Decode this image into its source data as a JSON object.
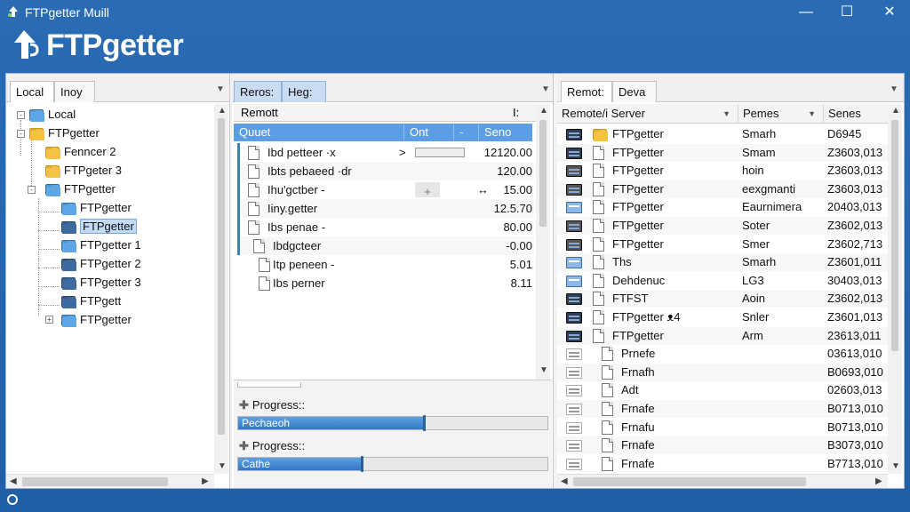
{
  "window": {
    "title": "FTPgetter Muill",
    "brand": "FTPgetter",
    "controls": {
      "minimize": "—",
      "maximize": "☐",
      "close": "✕"
    }
  },
  "left_pane": {
    "tabs": [
      {
        "label": "Local"
      },
      {
        "label": "Inoy"
      }
    ],
    "tree": [
      {
        "label": "Local",
        "icon": "folder-blue-icon"
      },
      {
        "label": "FTPgetter",
        "icon": "folder-yellow-icon"
      },
      {
        "label": "Fenncer 2",
        "icon": "folder-yellow-icon"
      },
      {
        "label": "FTPgeter 3",
        "icon": "folder-yellow-icon"
      },
      {
        "label": "FTPgetter",
        "icon": "folder-blue-icon"
      },
      {
        "label": "FTPgetter",
        "icon": "folder-blue-icon"
      },
      {
        "label": "FTPgetter",
        "icon": "folder-dark-icon",
        "selected": true
      },
      {
        "label": "FTPgetter 1",
        "icon": "folder-blue-icon"
      },
      {
        "label": "FTPgetter 2",
        "icon": "folder-dark-icon"
      },
      {
        "label": "FTPgetter 3",
        "icon": "folder-dark-icon"
      },
      {
        "label": "FTPgett",
        "icon": "folder-dark-icon"
      },
      {
        "label": "FTPgetter",
        "icon": "folder-blue-icon"
      }
    ]
  },
  "middle_pane": {
    "tabs": [
      {
        "label": "Reros:"
      },
      {
        "label": "Heg:"
      }
    ],
    "header_label": "Remott",
    "header_right": "I:",
    "queue_columns": [
      "Quuet",
      "Ont",
      "-",
      "Seno"
    ],
    "queue": [
      {
        "name": "Ibd petteer ·x",
        "value": "12120.00",
        "action": ">"
      },
      {
        "name": "Ibts pebaeed ·dr",
        "value": "120.00",
        "action": ""
      },
      {
        "name": "Ihu'gctber -",
        "value": "15.00",
        "action": "↔"
      },
      {
        "name": "Iiny.getter",
        "value": "12.5.70",
        "action": ""
      },
      {
        "name": "Ibs penae -",
        "value": "80.00",
        "action": ""
      },
      {
        "name": "Ibdgcteer",
        "value": "-0.00",
        "action": ""
      },
      {
        "name": "Itp peneen -",
        "value": "5.01",
        "action": ""
      },
      {
        "name": "Ibs perner",
        "value": "8.11",
        "action": ""
      }
    ],
    "progress": [
      {
        "label": "Progress::",
        "bar_text": "Pechaeoh",
        "fraction": 0.6
      },
      {
        "label": "Progress::",
        "bar_text": "Cathe",
        "fraction": 0.4
      }
    ]
  },
  "right_pane": {
    "tabs": [
      {
        "label": "Remot:"
      },
      {
        "label": "Deva"
      }
    ],
    "columns": [
      "Remote/i Server",
      "Pemes",
      "Senes"
    ],
    "rows": [
      {
        "name": "FTPgetter",
        "col2": "Smarh",
        "col3": "D6945",
        "icon": "folder"
      },
      {
        "name": "FTPgetter",
        "col2": "Smam",
        "col3": "Z3603,013",
        "icon": "file"
      },
      {
        "name": "FTPgetter",
        "col2": "hoin",
        "col3": "Z3603,013",
        "icon": "file"
      },
      {
        "name": "FTPgetter",
        "col2": "eexgmanti",
        "col3": "Z3603,013",
        "icon": "file"
      },
      {
        "name": "FTPgetter",
        "col2": "Eaurnimera",
        "col3": "20403,013",
        "icon": "file"
      },
      {
        "name": "FTPgetter",
        "col2": "Soter",
        "col3": "Z3602,013",
        "icon": "file"
      },
      {
        "name": "FTPgetter",
        "col2": "Smer",
        "col3": "Z3602,713",
        "icon": "file"
      },
      {
        "name": "Ths",
        "col2": "Smarh",
        "col3": "Z3601,011",
        "icon": "file"
      },
      {
        "name": "Dehdenuc",
        "col2": "LG3",
        "col3": "30403,013",
        "icon": "file"
      },
      {
        "name": "FTFST",
        "col2": "Aoin",
        "col3": "Z3602,013",
        "icon": "file"
      },
      {
        "name": "FTPgetter ᴥ4",
        "col2": "Snler",
        "col3": "Z3601,013",
        "icon": "file"
      },
      {
        "name": "FTPgetter",
        "col2": "Arm",
        "col3": "23613,011",
        "icon": "file"
      },
      {
        "name": "Prnefe",
        "col2": "",
        "col3": "03613,010",
        "icon": "file"
      },
      {
        "name": "Frnafh",
        "col2": "",
        "col3": "B0693,010",
        "icon": "file"
      },
      {
        "name": "Adt",
        "col2": "",
        "col3": "02603,013",
        "icon": "file"
      },
      {
        "name": "Frnafe",
        "col2": "",
        "col3": "B0713,010",
        "icon": "file"
      },
      {
        "name": "Frnafu",
        "col2": "",
        "col3": "B0713,010",
        "icon": "file"
      },
      {
        "name": "Frnafe",
        "col2": "",
        "col3": "B3073,010",
        "icon": "file"
      },
      {
        "name": "Frnafe",
        "col2": "",
        "col3": "B7713,010",
        "icon": "file"
      }
    ]
  }
}
